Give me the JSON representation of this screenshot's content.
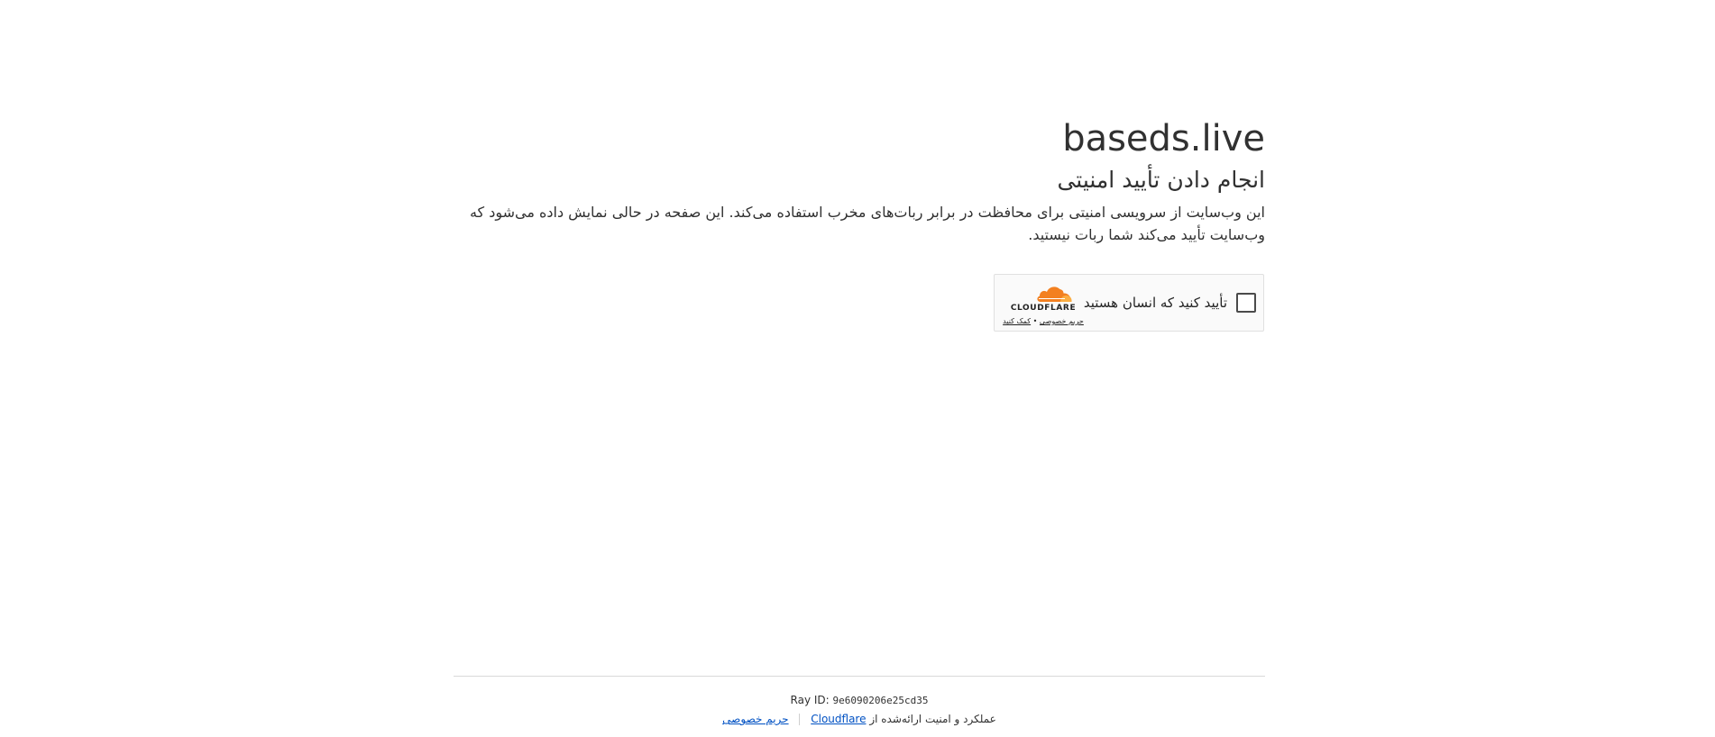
{
  "page": {
    "site_name": "baseds.live",
    "heading": "انجام دادن تأیید امنیتی",
    "description": "این وب‌سایت از سرویسی امنیتی برای محافظت در برابر ربات‌های مخرب استفاده می‌کند. این صفحه در حالی نمایش داده می‌شود که وب‌سایت تأیید می‌کند شما ربات نیستید."
  },
  "widget": {
    "label": "تأیید کنید که انسان هستید",
    "brand": "CLOUDFLARE",
    "privacy_link": "حریم خصوصی",
    "link_separator": "•",
    "help_link": "کمک کنید"
  },
  "footer": {
    "ray_label": "Ray ID:",
    "ray_id": "9e6090206e25cd35",
    "performance_text": "عملکرد و امنیت ارائه‌شده از",
    "cloudflare_link": "Cloudflare",
    "privacy_link": "حریم خصوصی"
  },
  "colors": {
    "text": "#313131",
    "link": "#0051c3",
    "cloudflare_orange": "#f38020",
    "cloudflare_orange_light": "#fbad41"
  }
}
